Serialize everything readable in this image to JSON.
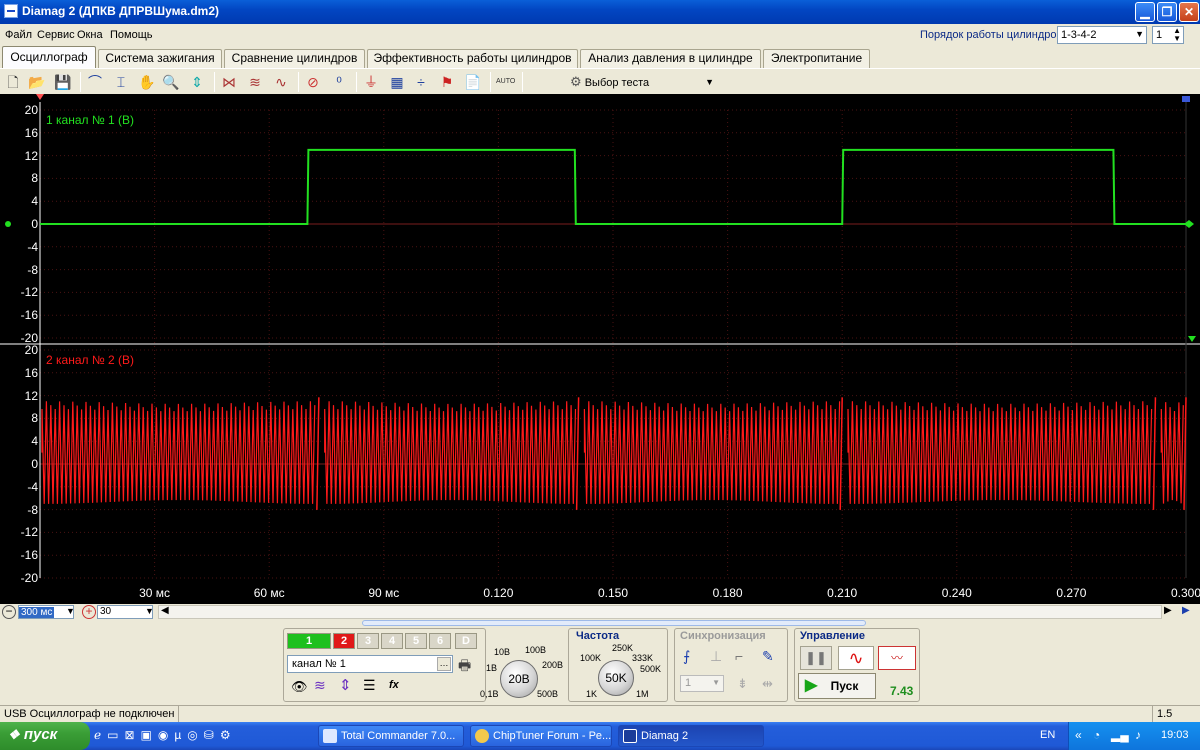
{
  "window": {
    "title": "Diamag 2 (ДПКВ ДПРВШума.dm2)",
    "min": "▁",
    "max": "❐",
    "close": "✕"
  },
  "menu": [
    "Файл",
    "Сервис",
    "Окна",
    "Помощь"
  ],
  "cylinder_order": {
    "label": "Порядок работы цилиндров",
    "value": "1-3-4-2",
    "number": "1"
  },
  "tabs": [
    "Осциллограф",
    "Система зажигания",
    "Сравнение цилиндров",
    "Эффективность работы цилиндров",
    "Анализ давления в цилиндре",
    "Электропитание"
  ],
  "toolbar": {
    "test_select": "Выбор теста",
    "auto_label": "AUTO"
  },
  "channel1": {
    "label": "1  канал № 1 (В)",
    "color": "#22e020",
    "y_ticks": [
      "20",
      "16",
      "12",
      "8",
      "4",
      "0",
      "-4",
      "-8",
      "-12",
      "-16",
      "-20"
    ],
    "pulses": [
      [
        70,
        140
      ],
      [
        210,
        281
      ]
    ],
    "high": 13,
    "low": 0
  },
  "channel2": {
    "label": "2  канал № 2 (В)",
    "color": "#ff1a1a",
    "y_ticks": [
      "20",
      "16",
      "12",
      "8",
      "4",
      "0",
      "-4",
      "-8",
      "-12",
      "-16",
      "-20"
    ],
    "bursts": [
      [
        0,
        73
      ],
      [
        74,
        141
      ],
      [
        142,
        210
      ],
      [
        211,
        292
      ],
      [
        293,
        300
      ]
    ],
    "amplitude_high": 11,
    "amplitude_low": -7
  },
  "x_axis": {
    "ticks": [
      "30 мс",
      "60 мс",
      "90 мс",
      "0.120",
      "0.150",
      "0.180",
      "0.210",
      "0.240",
      "0.270",
      "0.300"
    ],
    "range_ms": [
      0,
      300
    ]
  },
  "scroll": {
    "timebase": "300 мс",
    "zoom": "30"
  },
  "channels_buttons": [
    "1",
    "2",
    "3",
    "4",
    "5",
    "6",
    "D"
  ],
  "channel_select": "канал № 1",
  "volts_knob": {
    "value": "20В",
    "labels": [
      "10В",
      "100В",
      "1В",
      "200В",
      "0,1В",
      "500В"
    ]
  },
  "freq": {
    "title": "Частота",
    "value": "50K",
    "labels": [
      "250K",
      "100K",
      "333K",
      "500K",
      "1K",
      "1M"
    ]
  },
  "sync": {
    "title": "Синхронизация",
    "value": "1"
  },
  "control": {
    "title": "Управление",
    "start": "Пуск",
    "reading": "7.43"
  },
  "status": {
    "text": "USB Осциллограф не подключен",
    "right": "1.5"
  },
  "taskbar": {
    "start": "пуск",
    "items": [
      "Total Commander 7.0...",
      "ChipTuner Forum - Pe...",
      "Diamag 2"
    ],
    "lang": "EN",
    "clock": "19:03"
  }
}
